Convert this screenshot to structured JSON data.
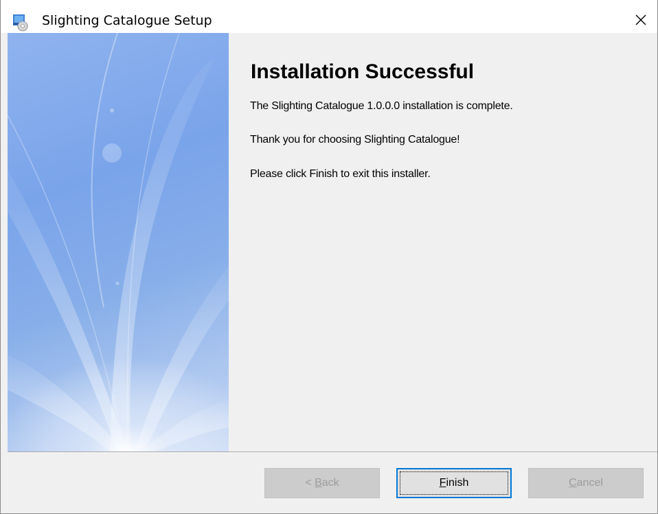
{
  "window": {
    "title": "Slighting Catalogue Setup",
    "close_symbol": "✕"
  },
  "icons": {
    "app": "installer-package-icon",
    "close": "close-icon"
  },
  "content": {
    "heading": "Installation Successful",
    "line1": "The Slighting Catalogue 1.0.0.0 installation is complete.",
    "line2": "Thank you for choosing Slighting Catalogue!",
    "line3": "Please click Finish to exit this installer."
  },
  "buttons": {
    "back": {
      "prefix": "< ",
      "mnemonic": "B",
      "rest": "ack",
      "enabled": false
    },
    "finish": {
      "prefix": "",
      "mnemonic": "F",
      "rest": "inish",
      "enabled": true
    },
    "cancel": {
      "prefix": "",
      "mnemonic": "C",
      "rest": "ancel",
      "enabled": false
    }
  },
  "colors": {
    "focus_accent": "#0078d7",
    "panel_blue": "#7aa4ea",
    "dialog_bg": "#f0f0f0"
  }
}
